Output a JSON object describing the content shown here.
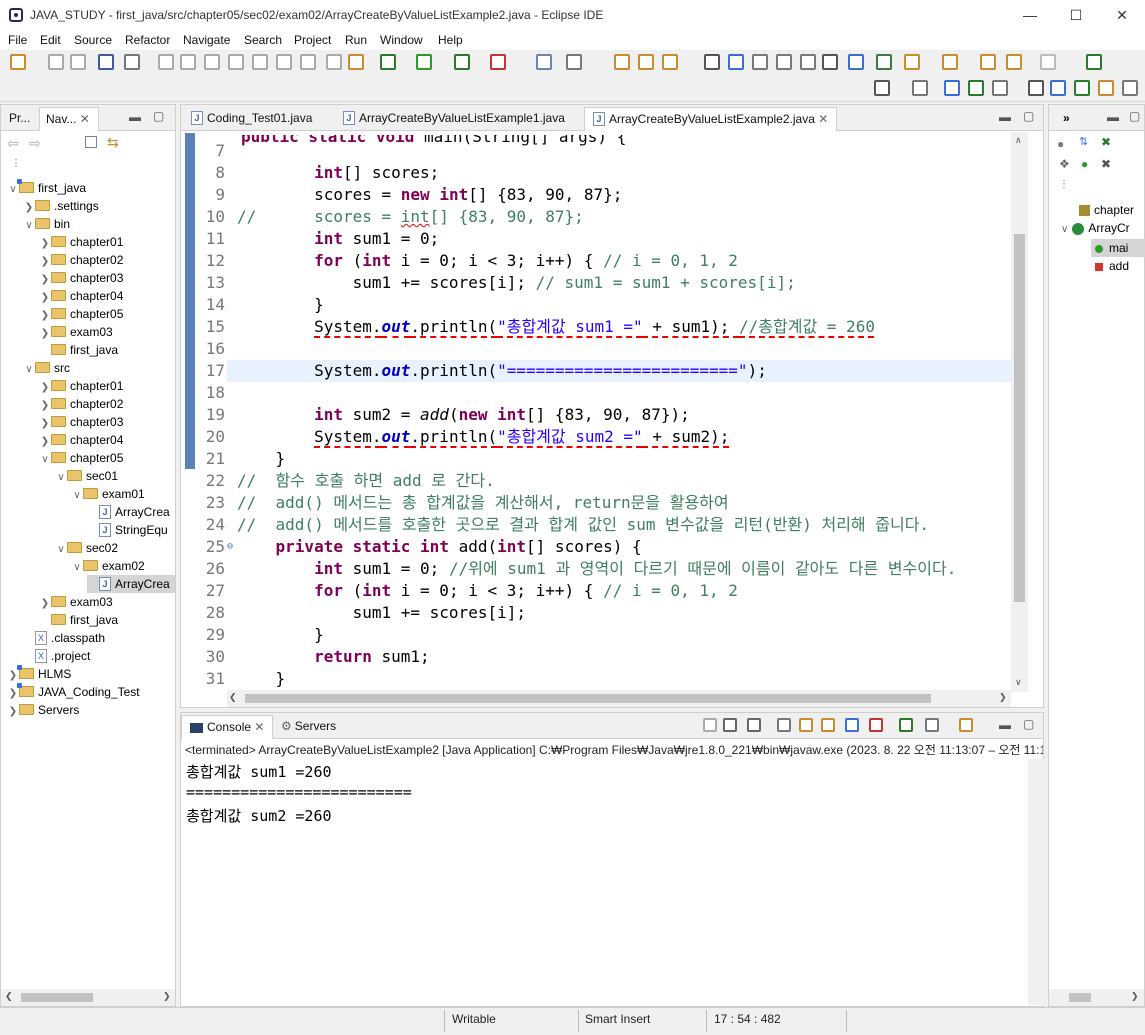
{
  "window": {
    "title": "JAVA_STUDY - first_java/src/chapter05/sec02/exam02/ArrayCreateByValueListExample2.java - Eclipse IDE"
  },
  "menu": [
    "File",
    "Edit",
    "Source",
    "Refactor",
    "Navigate",
    "Search",
    "Project",
    "Run",
    "Window",
    "Help"
  ],
  "left_panel": {
    "tabs": [
      "Pr...",
      "Nav..."
    ],
    "tree": [
      {
        "label": "first_java",
        "level": 0,
        "icon": "project-icon",
        "expanded": true
      },
      {
        "label": ".settings",
        "level": 1,
        "icon": "folder-icon",
        "expanded": false
      },
      {
        "label": "bin",
        "level": 1,
        "icon": "folder-icon",
        "expanded": true
      },
      {
        "label": "chapter01",
        "level": 2,
        "icon": "folder-icon",
        "expanded": false
      },
      {
        "label": "chapter02",
        "level": 2,
        "icon": "folder-icon",
        "expanded": false
      },
      {
        "label": "chapter03",
        "level": 2,
        "icon": "folder-icon",
        "expanded": false
      },
      {
        "label": "chapter04",
        "level": 2,
        "icon": "folder-icon",
        "expanded": false
      },
      {
        "label": "chapter05",
        "level": 2,
        "icon": "folder-icon",
        "expanded": false
      },
      {
        "label": "exam03",
        "level": 2,
        "icon": "folder-icon",
        "expanded": false
      },
      {
        "label": "first_java",
        "level": 2,
        "icon": "folder-icon",
        "expanded": null
      },
      {
        "label": "src",
        "level": 1,
        "icon": "folder-icon",
        "expanded": true
      },
      {
        "label": "chapter01",
        "level": 2,
        "icon": "folder-icon",
        "expanded": false
      },
      {
        "label": "chapter02",
        "level": 2,
        "icon": "folder-icon",
        "expanded": false
      },
      {
        "label": "chapter03",
        "level": 2,
        "icon": "folder-icon",
        "expanded": false
      },
      {
        "label": "chapter04",
        "level": 2,
        "icon": "folder-icon",
        "expanded": false
      },
      {
        "label": "chapter05",
        "level": 2,
        "icon": "folder-icon",
        "expanded": true
      },
      {
        "label": "sec01",
        "level": 3,
        "icon": "folder-icon",
        "expanded": true
      },
      {
        "label": "exam01",
        "level": 4,
        "icon": "folder-icon",
        "expanded": true
      },
      {
        "label": "ArrayCrea",
        "level": 5,
        "icon": "java-file-icon",
        "expanded": null
      },
      {
        "label": "StringEqu",
        "level": 5,
        "icon": "java-file-icon",
        "expanded": null
      },
      {
        "label": "sec02",
        "level": 3,
        "icon": "folder-icon",
        "expanded": true
      },
      {
        "label": "exam02",
        "level": 4,
        "icon": "folder-icon",
        "expanded": true
      },
      {
        "label": "ArrayCrea",
        "level": 5,
        "icon": "java-file-icon",
        "expanded": null,
        "selected": true
      },
      {
        "label": "exam03",
        "level": 2,
        "icon": "folder-icon",
        "expanded": false
      },
      {
        "label": "first_java",
        "level": 2,
        "icon": "folder-icon",
        "expanded": null
      },
      {
        "label": ".classpath",
        "level": 1,
        "icon": "xml-file-icon",
        "expanded": null
      },
      {
        "label": ".project",
        "level": 1,
        "icon": "xml-file-icon",
        "expanded": null
      },
      {
        "label": "HLMS",
        "level": 0,
        "icon": "project-icon",
        "expanded": false
      },
      {
        "label": "JAVA_Coding_Test",
        "level": 0,
        "icon": "project-icon",
        "expanded": false
      },
      {
        "label": "Servers",
        "level": 0,
        "icon": "folder-icon",
        "expanded": false
      }
    ]
  },
  "editor": {
    "tabs": [
      "Coding_Test01.java",
      "ArrayCreateByValueListExample1.java",
      "ArrayCreateByValueListExample2.java"
    ],
    "active_tab": 2,
    "lines": [
      {
        "n": "7",
        "html": ""
      },
      {
        "n": "8",
        "html": "        <span class=\"kw\">int</span>[] scores;"
      },
      {
        "n": "9",
        "html": "        scores = <span class=\"kw\">new</span> <span class=\"kw\">int</span>[] {83, 90, 87};"
      },
      {
        "n": "10",
        "html": "<span class=\"cm\">//      scores = <span class=\"err\">int</span>[] {83, 90, 87};</span>"
      },
      {
        "n": "11",
        "html": "        <span class=\"kw\">int</span> sum1 = 0;"
      },
      {
        "n": "12",
        "html": "        <span class=\"kw\">for</span> (<span class=\"kw\">int</span> i = 0; i &lt; 3; i++) { <span class=\"cm\">// i = 0, 1, 2</span>"
      },
      {
        "n": "13",
        "html": "            sum1 += scores[i]; <span class=\"cm\">// sum1 = sum1 + scores[i];</span>"
      },
      {
        "n": "14",
        "html": "        }"
      },
      {
        "n": "15",
        "html": "        <span class=\"wavy\">System.<span class=\"fld\">out</span>.println(<span class=\"str\">\"총합계값 sum1 =\"</span> + sum1); <span class=\"cm\">//총합계값 = 260</span></span>"
      },
      {
        "n": "16",
        "html": ""
      },
      {
        "n": "17",
        "html": "        System.<span class=\"fld\">out</span>.println(<span class=\"str\">\"========================\"</span>);",
        "current": true
      },
      {
        "n": "18",
        "html": ""
      },
      {
        "n": "19",
        "html": "        <span class=\"kw\">int</span> sum2 = <span class=\"mth\">add</span>(<span class=\"kw\">new</span> <span class=\"kw\">int</span>[] {83, 90, 87});"
      },
      {
        "n": "20",
        "html": "        <span class=\"wavy\">System.<span class=\"fld\">out</span>.println(<span class=\"str\">\"총합계값 sum2 =\"</span> + sum2);</span>"
      },
      {
        "n": "21",
        "html": "    }"
      },
      {
        "n": "22",
        "html": "<span class=\"cm\">//  함수 호출 하면 add 로 간다.</span>"
      },
      {
        "n": "23",
        "html": "<span class=\"cm\">//  add() 메서드는 총 합계값을 계산해서, return문을 활용하여</span>"
      },
      {
        "n": "24",
        "html": "<span class=\"cm\">//  add() 메서드를 호출한 곳으로 결과 합계 값인 sum 변수값을 리턴(반환) 처리해 줍니다.</span>"
      },
      {
        "n": "25",
        "html": "    <span class=\"kw\">private</span> <span class=\"kw\">static</span> <span class=\"kw\">int</span> add(<span class=\"kw\">int</span>[] scores) {",
        "fold": true
      },
      {
        "n": "26",
        "html": "        <span class=\"kw\">int</span> sum1 = 0; <span class=\"cm\">//위에 sum1 과 영역이 다르기 때문에 이름이 같아도 다른 변수이다.</span>"
      },
      {
        "n": "27",
        "html": "        <span class=\"kw\">for</span> (<span class=\"kw\">int</span> i = 0; i &lt; 3; i++) { <span class=\"cm\">// i = 0, 1, 2</span>"
      },
      {
        "n": "28",
        "html": "            sum1 += scores[i];"
      },
      {
        "n": "29",
        "html": "        }"
      },
      {
        "n": "30",
        "html": "        <span class=\"kw\">return</span> sum1;"
      },
      {
        "n": "31",
        "html": "    }"
      }
    ]
  },
  "outline": {
    "items": [
      {
        "label": "chapter"
      },
      {
        "label": "ArrayCr"
      },
      {
        "label": "mai"
      },
      {
        "label": "add"
      }
    ]
  },
  "console": {
    "tabs": [
      "Console",
      "Servers"
    ],
    "header": "<terminated> ArrayCreateByValueListExample2 [Java Application] C:₩Program Files₩Java₩jre1.8.0_221₩bin₩javaw.exe  (2023. 8. 22 오전 11:13:07 – 오전 11:1",
    "lines": [
      "총합계값 sum1 =260",
      "=========================",
      "총합계값 sum2 =260"
    ]
  },
  "status": {
    "writable": "Writable",
    "insert_mode": "Smart Insert",
    "position": "17 : 54 : 482"
  }
}
